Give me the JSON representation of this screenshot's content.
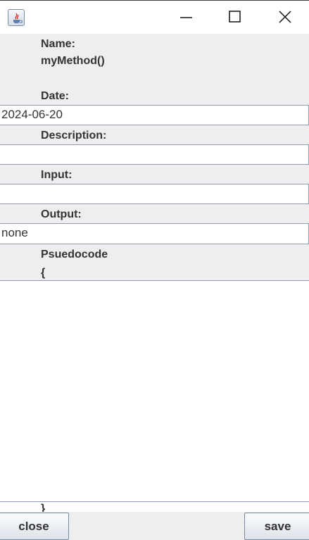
{
  "window": {
    "icons": {
      "app": "java-cup-icon",
      "minimize": "minimize-icon",
      "maximize": "maximize-icon",
      "close": "close-icon"
    }
  },
  "form": {
    "name_label": "Name:",
    "name_value": "myMethod()",
    "date_label": "Date:",
    "date_value": "2024-06-20",
    "description_label": "Description:",
    "description_value": "",
    "input_label": "Input:",
    "input_value": "",
    "output_label": "Output:",
    "output_value": "none",
    "pseudocode_label": "Psuedocode",
    "pseudocode_open": "{",
    "pseudocode_body": "",
    "pseudocode_close": "}"
  },
  "buttons": {
    "close_label": "close",
    "save_label": "save"
  }
}
